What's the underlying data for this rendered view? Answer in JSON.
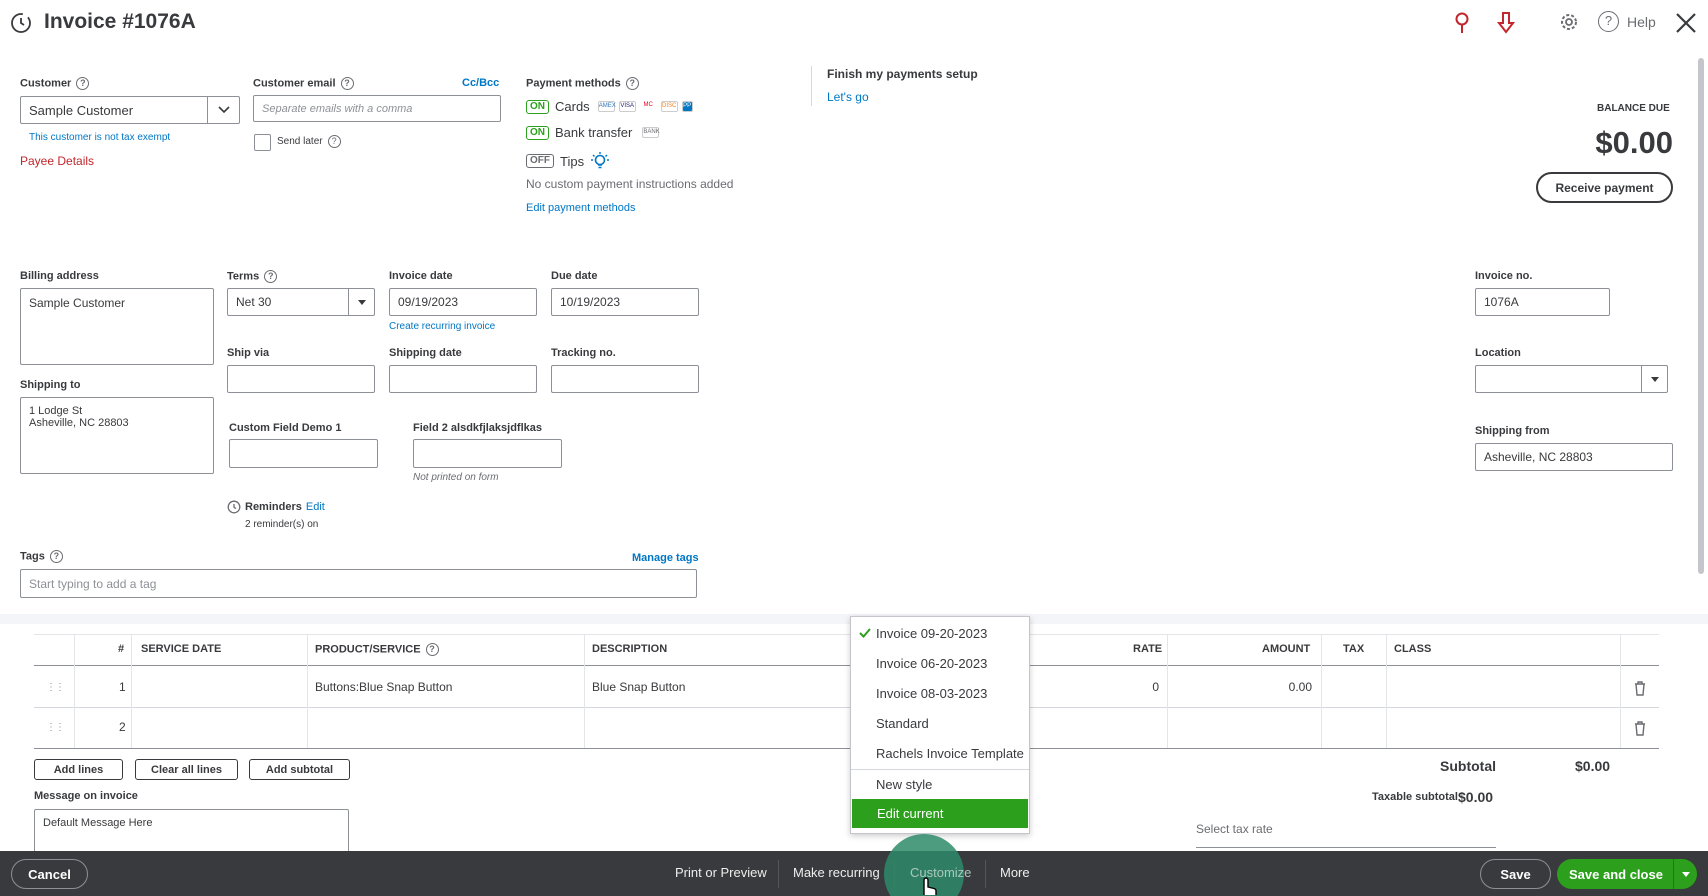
{
  "header": {
    "title": "Invoice #1076A",
    "help_label": "Help"
  },
  "customer": {
    "label": "Customer",
    "value": "Sample Customer",
    "tax_note": "This customer is not tax exempt",
    "payee_details": "Payee Details"
  },
  "email": {
    "label": "Customer email",
    "ccbcc": "Cc/Bcc",
    "placeholder": "Separate emails with a comma",
    "send_later": "Send later"
  },
  "payments": {
    "label": "Payment methods",
    "cards_toggle": "ON",
    "cards_label": "Cards",
    "card_icons": [
      "amex-icon",
      "visa-icon",
      "mastercard-icon",
      "discover-icon",
      "other-card-icon"
    ],
    "card_texts": [
      "AMEX",
      "VISA",
      "MC",
      "DISC",
      "PP"
    ],
    "bank_toggle": "ON",
    "bank_label": "Bank transfer",
    "bank_icon_text": "BANK",
    "tips_toggle": "OFF",
    "tips_label": "Tips",
    "no_instructions": "No custom payment instructions added",
    "edit_methods": "Edit payment methods"
  },
  "setup": {
    "title": "Finish my payments setup",
    "link": "Let's go"
  },
  "balance": {
    "label": "BALANCE DUE",
    "amount": "$0.00",
    "receive_button": "Receive payment"
  },
  "billing": {
    "label": "Billing address",
    "value": "Sample Customer"
  },
  "terms": {
    "label": "Terms",
    "value": "Net 30"
  },
  "invoice_date": {
    "label": "Invoice date",
    "value": "09/19/2023",
    "recurring_link": "Create recurring invoice"
  },
  "due_date": {
    "label": "Due date",
    "value": "10/19/2023"
  },
  "invoice_no": {
    "label": "Invoice no.",
    "value": "1076A"
  },
  "shipping": {
    "ship_via_label": "Ship via",
    "shipping_date_label": "Shipping date",
    "tracking_label": "Tracking no.",
    "shipping_to_label": "Shipping to",
    "shipping_to_line1": "1 Lodge St",
    "shipping_to_line2": "Asheville, NC 28803",
    "location_label": "Location",
    "shipping_from_label": "Shipping from",
    "shipping_from_value": "Asheville, NC 28803"
  },
  "custom_fields": {
    "field1_label": "Custom Field Demo 1",
    "field2_label": "Field 2 alsdkfjlaksjdflkas",
    "not_printed": "Not printed on form"
  },
  "reminders": {
    "label": "Reminders",
    "edit": "Edit",
    "status": "2 reminder(s) on"
  },
  "tags": {
    "label": "Tags",
    "manage": "Manage tags",
    "placeholder": "Start typing to add a tag"
  },
  "table": {
    "headers": {
      "num": "#",
      "service_date": "SERVICE DATE",
      "product": "PRODUCT/SERVICE",
      "description": "DESCRIPTION",
      "rate": "RATE",
      "amount": "AMOUNT",
      "tax": "TAX",
      "class": "CLASS"
    },
    "rows": [
      {
        "num": "1",
        "product": "Buttons:Blue Snap Button",
        "description": "Blue Snap Button",
        "rate": "0",
        "amount": "0.00"
      },
      {
        "num": "2",
        "product": "",
        "description": "",
        "rate": "",
        "amount": ""
      }
    ],
    "add_lines": "Add lines",
    "clear_lines": "Clear all lines",
    "add_subtotal": "Add subtotal"
  },
  "totals": {
    "subtotal_label": "Subtotal",
    "subtotal_value": "$0.00",
    "taxable_label": "Taxable subtotal",
    "taxable_value": "$0.00",
    "tax_rate_label": "Select tax rate"
  },
  "message": {
    "label": "Message on invoice",
    "value": "Default Message Here"
  },
  "customize_menu": {
    "items": [
      "Invoice 09-20-2023",
      "Invoice 06-20-2023",
      "Invoice 08-03-2023",
      "Standard",
      "Rachels Invoice Template",
      "New style",
      "Edit current"
    ],
    "checked_index": 0,
    "highlighted_index": 6
  },
  "footer": {
    "cancel": "Cancel",
    "print_preview": "Print or Preview",
    "make_recurring": "Make recurring",
    "customize": "Customize",
    "more": "More",
    "save": "Save",
    "save_close": "Save and close"
  },
  "colors": {
    "green": "#2ca01c",
    "link": "#0077c5",
    "footer_bg": "#393a3d",
    "payee": "#c1272d"
  }
}
